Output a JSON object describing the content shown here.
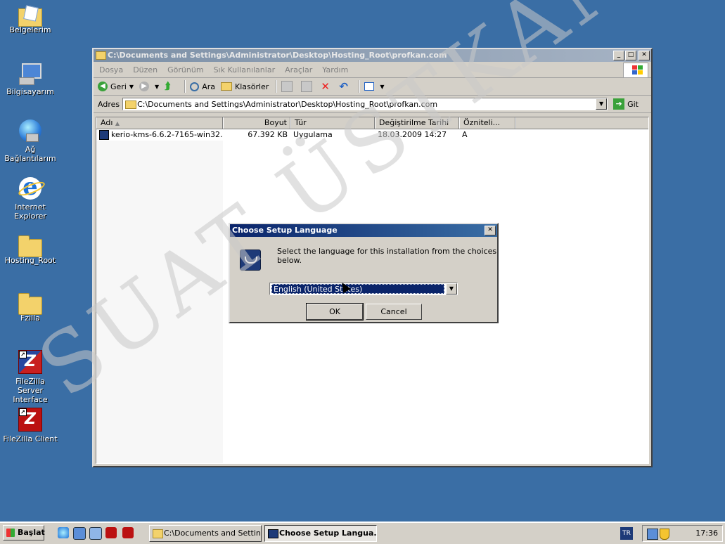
{
  "desktop": {
    "icons": [
      {
        "label": "Belgelerim"
      },
      {
        "label": "Bilgisayarım"
      },
      {
        "label": "Ağ\nBağlantılarım"
      },
      {
        "label": "Internet\nExplorer"
      },
      {
        "label": "Hosting_Root"
      },
      {
        "label": "Fzilla"
      },
      {
        "label": "FileZilla Server\nInterface"
      },
      {
        "label": "FileZilla Client"
      }
    ]
  },
  "explorer": {
    "title": "C:\\Documents and Settings\\Administrator\\Desktop\\Hosting_Root\\profkan.com",
    "menu": [
      "Dosya",
      "Düzen",
      "Görünüm",
      "Sık Kullanılanlar",
      "Araçlar",
      "Yardım"
    ],
    "toolbar": {
      "back": "Geri",
      "search": "Ara",
      "folders": "Klasörler"
    },
    "address_label": "Adres",
    "address_value": "C:\\Documents and Settings\\Administrator\\Desktop\\Hosting_Root\\profkan.com",
    "go_label": "Git",
    "columns": [
      "Adı",
      "Boyut",
      "Tür",
      "Değiştirilme Tarihi",
      "Özniteli..."
    ],
    "files": [
      {
        "name": "kerio-kms-6.6.2-7165-win32....",
        "size": "67.392 KB",
        "type": "Uygulama",
        "modified": "18.03.2009 14:27",
        "attr": "A"
      }
    ]
  },
  "dialog": {
    "title": "Choose Setup Language",
    "message": "Select the language for this installation from the choices below.",
    "language_selected": "English (United States)",
    "ok_label": "OK",
    "cancel_label": "Cancel"
  },
  "taskbar": {
    "start_label": "Başlat",
    "tasks": [
      {
        "label": "C:\\Documents and Settin..."
      },
      {
        "label": "Choose Setup Langua..."
      }
    ],
    "language": "TR",
    "clock": "17:36"
  },
  "watermark": "SUAT ÜSTKAN",
  "colors": {
    "desktop": "#3a6ea5",
    "active_title": "#0a246a",
    "inactive_title": "#7b8fa6",
    "window_face": "#d4d0c8"
  }
}
